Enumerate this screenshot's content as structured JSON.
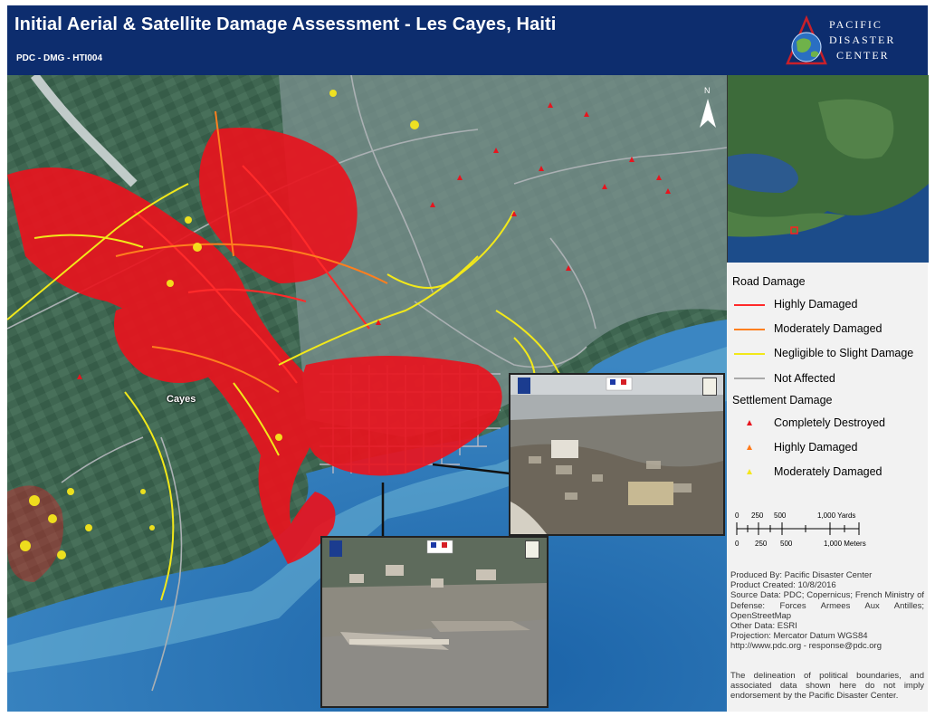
{
  "header": {
    "title": "Initial Aerial & Satellite Damage Assessment - Les Cayes, Haiti",
    "code": "PDC - DMG - HTI004",
    "logo_lines": [
      "PACIFIC",
      "DISASTER",
      "CENTER"
    ]
  },
  "map": {
    "city_label": "Cayes",
    "north_label": "N"
  },
  "legend": {
    "road_title": "Road Damage",
    "road_items": [
      {
        "label": "Highly Damaged",
        "color": "#ff2a2a"
      },
      {
        "label": "Moderately Damaged",
        "color": "#ff7f1e"
      },
      {
        "label": "Negligible to Slight Damage",
        "color": "#f2e81a"
      },
      {
        "label": "Not Affected",
        "color": "#a9a9a9"
      }
    ],
    "settlement_title": "Settlement Damage",
    "settlement_items": [
      {
        "label": "Completely Destroyed",
        "color": "#e8141e"
      },
      {
        "label": "Highly Damaged",
        "color": "#ff7a1a"
      },
      {
        "label": "Moderately Damaged",
        "color": "#f5e61c"
      }
    ]
  },
  "scale": {
    "yard_labels": [
      "0",
      "250",
      "500",
      "1,000 Yards"
    ],
    "meter_labels": [
      "0",
      "250",
      "500",
      "1,000 Meters"
    ]
  },
  "credits": {
    "produced_by": "Produced By: Pacific Disaster Center",
    "created": "Product Created: 10/8/2016",
    "source": "Source Data: PDC; Copernicus; French Ministry of Defense: Forces Armees Aux Antilles; OpenStreetMap",
    "other": "Other Data: ESRI",
    "projection": "Projection: Mercator Datum WGS84",
    "web": "http://www.pdc.org - response@pdc.org"
  },
  "disclaimer": "The delineation of political boundaries, and associated data shown here do not imply endorsement by the Pacific Disaster Center."
}
